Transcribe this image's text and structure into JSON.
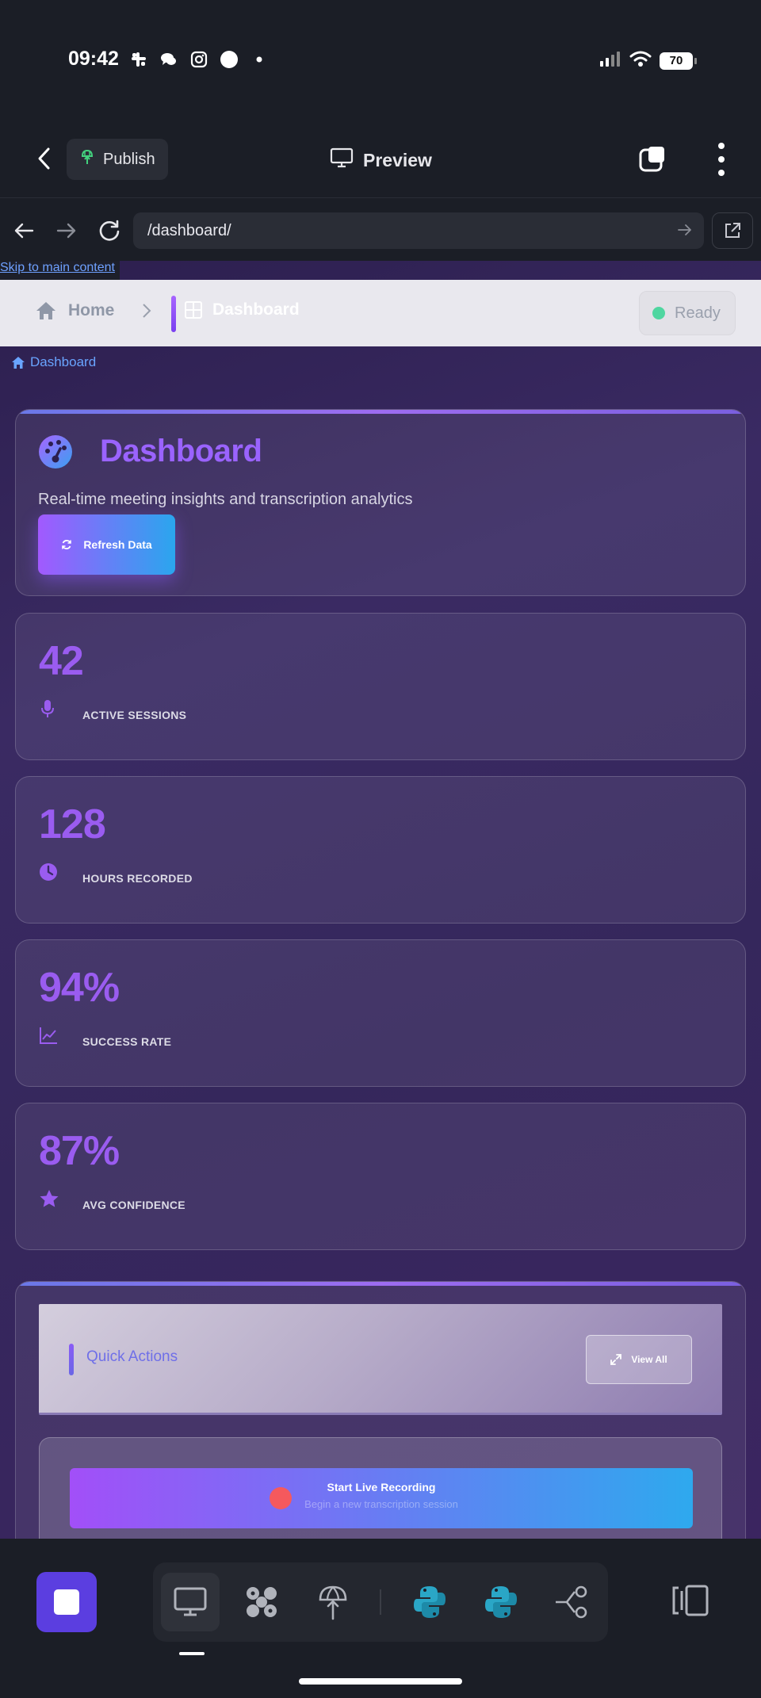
{
  "status_bar": {
    "time": "09:42",
    "battery": "70"
  },
  "app_bar": {
    "publish_label": "Publish",
    "preview_label": "Preview"
  },
  "url_bar": {
    "url": "/dashboard/"
  },
  "page": {
    "skip_link": "Skip to main content",
    "topnav": {
      "home": "Home",
      "dashboard": "Dashboard",
      "status": "Ready"
    },
    "breadcrumb": "Dashboard",
    "hero": {
      "title": "Dashboard",
      "subtitle": "Real-time meeting insights and transcription analytics",
      "refresh_label": "Refresh Data"
    },
    "stats": [
      {
        "value": "42",
        "label": "ACTIVE SESSIONS",
        "icon": "microphone-icon"
      },
      {
        "value": "128",
        "label": "HOURS RECORDED",
        "icon": "clock-icon"
      },
      {
        "value": "94%",
        "label": "SUCCESS RATE",
        "icon": "chart-line-icon"
      },
      {
        "value": "87%",
        "label": "AVG CONFIDENCE",
        "icon": "star-icon"
      }
    ],
    "quick_actions": {
      "title": "Quick Actions",
      "view_all_label": "View All",
      "record_title": "Start Live Recording",
      "record_subtitle": "Begin a new transcription session"
    }
  },
  "colors": {
    "accent_purple": "#9a5cf0",
    "accent_blue": "#2aa6ee",
    "status_green": "#4fd6a0",
    "record_red": "#f5595d",
    "stop_button": "#5b3ee0"
  }
}
